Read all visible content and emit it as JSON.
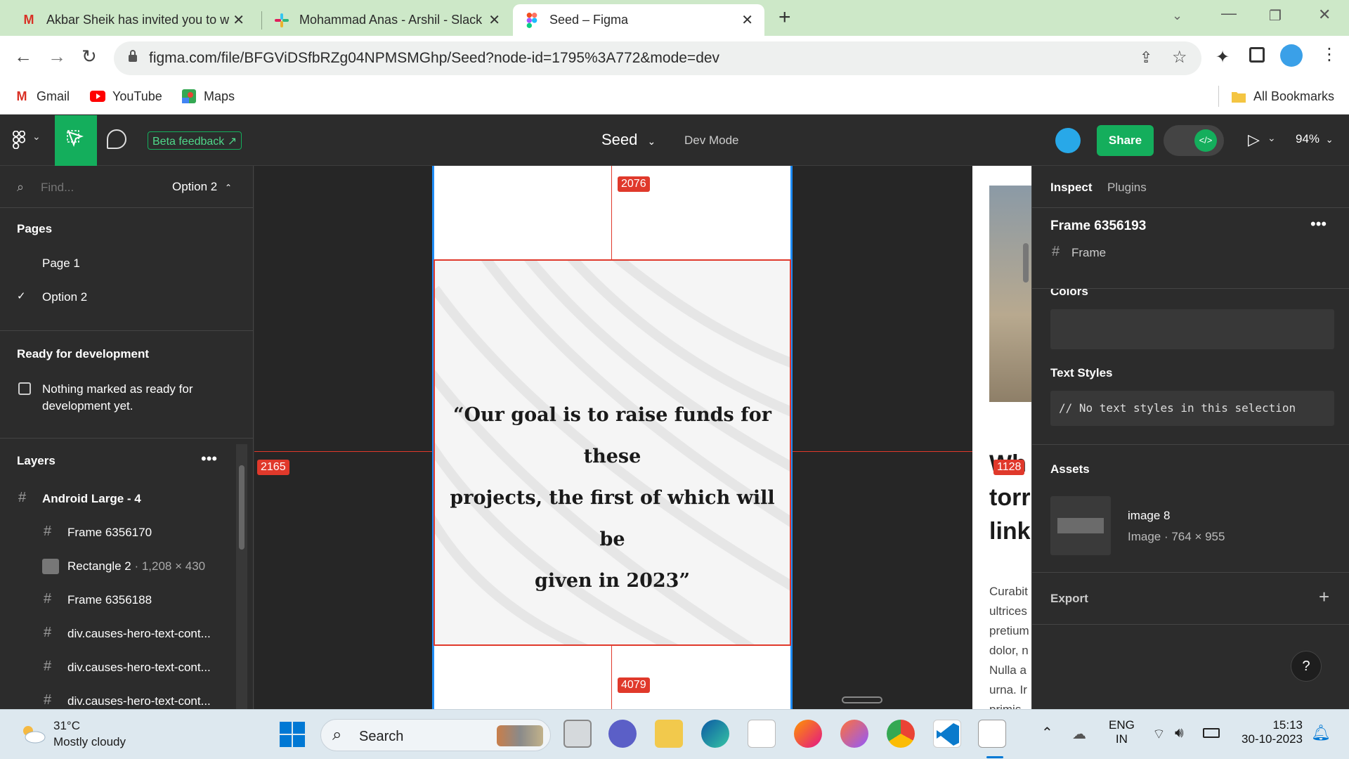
{
  "browser": {
    "tabs": [
      {
        "title": "Akbar Sheik has invited you to w",
        "icon": "gmail-icon"
      },
      {
        "title": "Mohammad Anas - Arshil - Slack",
        "icon": "slack-icon"
      },
      {
        "title": "Seed – Figma",
        "icon": "figma-icon",
        "active": true
      }
    ],
    "url": "figma.com/file/BFGViDSfbRZg04NPMSMGhp/Seed?node-id=1795%3A772&mode=dev",
    "bookmarks": [
      {
        "label": "Gmail",
        "icon": "gmail-icon"
      },
      {
        "label": "YouTube",
        "icon": "youtube-icon"
      },
      {
        "label": "Maps",
        "icon": "maps-icon"
      }
    ],
    "all_bookmarks": "All Bookmarks"
  },
  "figma": {
    "toolbar": {
      "beta_feedback": "Beta feedback",
      "file_name": "Seed",
      "mode_label": "Dev Mode",
      "share_label": "Share",
      "zoom": "94%"
    },
    "left": {
      "find_placeholder": "Find...",
      "current_page": "Option 2",
      "pages_heading": "Pages",
      "pages": [
        "Page 1",
        "Option 2"
      ],
      "ready_heading": "Ready for development",
      "ready_message_line1": "Nothing marked as ready for",
      "ready_message_line2": "development yet.",
      "layers_heading": "Layers",
      "layers": [
        {
          "name": "Android Large - 4",
          "type": "frame",
          "bold": true
        },
        {
          "name": "Frame 6356170",
          "type": "frame"
        },
        {
          "name": "Rectangle 2",
          "dims": " · 1,208 × 430",
          "type": "image"
        },
        {
          "name": "Frame 6356188",
          "type": "frame"
        },
        {
          "name": "div.causes-hero-text-cont...",
          "type": "frame"
        },
        {
          "name": "div.causes-hero-text-cont...",
          "type": "frame"
        },
        {
          "name": "div.causes-hero-text-cont...",
          "type": "frame"
        }
      ]
    },
    "canvas": {
      "measure_top": "2076",
      "measure_left": "2165",
      "measure_right": "1128",
      "measure_bottom": "4079",
      "quote_line1": "“Our goal is to raise funds for these",
      "quote_line2": "projects, the first of which will be",
      "quote_line3": "given in 2023”",
      "right_heading_1": "Wh",
      "right_heading_2": "torr",
      "right_heading_3": "link",
      "right_body": [
        "Curabit",
        "ultrices",
        "pretium",
        "dolor, n",
        "Nulla a",
        "urna. Ir",
        "primis"
      ]
    },
    "right": {
      "tab_inspect": "Inspect",
      "tab_plugins": "Plugins",
      "frame_name": "Frame 6356193",
      "frame_type": "Frame",
      "colors_heading": "Colors",
      "text_styles_heading": "Text Styles",
      "text_styles_empty": "// No text styles in this selection",
      "assets_heading": "Assets",
      "asset_name": "image 8",
      "asset_meta": "Image · 764 × 955",
      "export_heading": "Export",
      "help": "?"
    }
  },
  "taskbar": {
    "weather_temp": "31°C",
    "weather_desc": "Mostly cloudy",
    "search_placeholder": "Search",
    "lang_line1": "ENG",
    "lang_line2": "IN",
    "time": "15:13",
    "date": "30-10-2023"
  }
}
